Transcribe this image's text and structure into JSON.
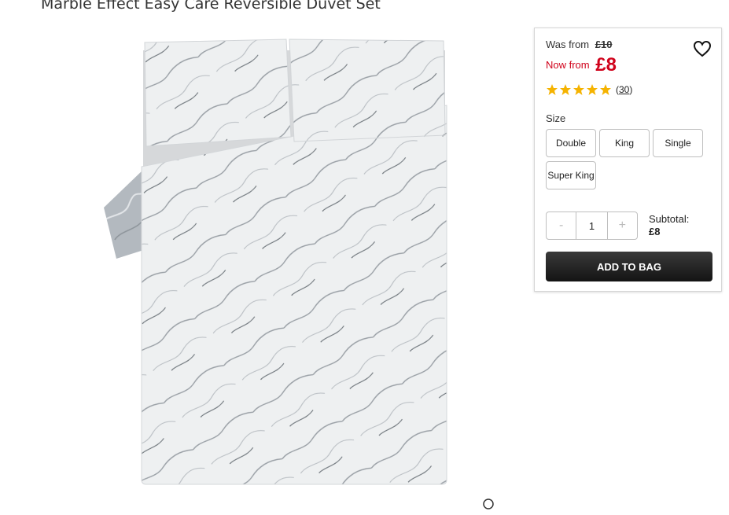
{
  "product": {
    "title": "Marble Effect Easy Care Reversible Duvet Set",
    "image_alt": "marble-duvet-set-photo"
  },
  "pricing": {
    "was_label": "Was from",
    "was_price": "£10",
    "now_label": "Now from",
    "now_price": "£8",
    "accent_color": "#d0021b"
  },
  "rating": {
    "stars": 5,
    "review_count": "30",
    "star_color": "#f5b301"
  },
  "size": {
    "label": "Size",
    "options": [
      "Double",
      "King",
      "Single",
      "Super King"
    ]
  },
  "quantity": {
    "decrement": "-",
    "value": "1",
    "increment": "+"
  },
  "subtotal": {
    "label": "Subtotal:",
    "amount": "£8"
  },
  "actions": {
    "add_to_bag": "ADD TO BAG",
    "wishlist_icon": "heart-icon",
    "zoom_icon": "zoom-icon"
  }
}
